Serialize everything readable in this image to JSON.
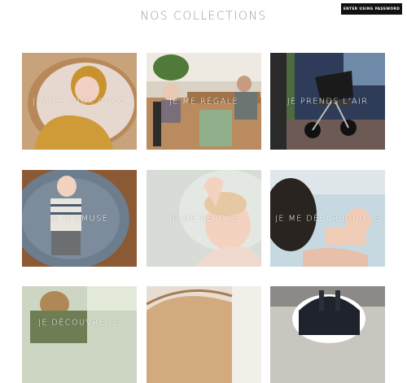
{
  "header": {
    "title": "NOS COLLECTIONS",
    "password_button_label": "ENTER USING PASSWORD"
  },
  "collections": [
    {
      "label": "J'AI LE LOOK COCO"
    },
    {
      "label": "JE ME RÉGALE"
    },
    {
      "label": "JE PRENDS L'AIR"
    },
    {
      "label": "JE M'AMUSE"
    },
    {
      "label": "JE ME REPOSE"
    },
    {
      "label": "JE ME DÉBARBOUILLE"
    },
    {
      "label": "JE DÉCOUVRE LE"
    },
    {
      "label": ""
    },
    {
      "label": ""
    }
  ]
}
